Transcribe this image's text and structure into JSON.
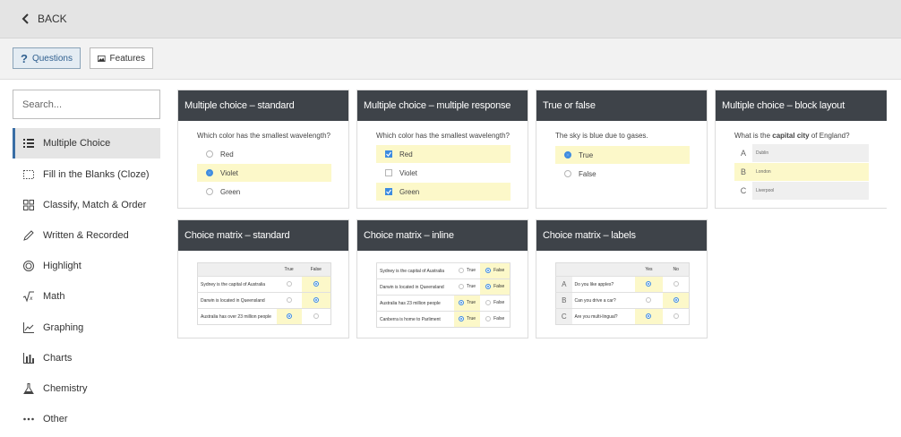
{
  "topbar": {
    "back_label": "BACK"
  },
  "tabs": [
    {
      "label": "Questions",
      "active": true
    },
    {
      "label": "Features",
      "active": false
    }
  ],
  "search": {
    "placeholder": "Search..."
  },
  "sidebar": {
    "items": [
      {
        "label": "Multiple Choice",
        "icon": "list-icon",
        "active": true
      },
      {
        "label": "Fill in the Blanks (Cloze)",
        "icon": "dashed-box-icon"
      },
      {
        "label": "Classify, Match & Order",
        "icon": "grid-icon"
      },
      {
        "label": "Written & Recorded",
        "icon": "pencil-icon"
      },
      {
        "label": "Highlight",
        "icon": "target-icon"
      },
      {
        "label": "Math",
        "icon": "sqrt-icon"
      },
      {
        "label": "Graphing",
        "icon": "line-graph-icon"
      },
      {
        "label": "Charts",
        "icon": "bar-chart-icon"
      },
      {
        "label": "Chemistry",
        "icon": "flask-icon"
      },
      {
        "label": "Other",
        "icon": "more-icon"
      }
    ]
  },
  "cards": {
    "mc_standard": {
      "title": "Multiple choice – standard",
      "question": "Which color has the smallest wavelength?",
      "options": [
        "Red",
        "Violet",
        "Green"
      ]
    },
    "mc_multi": {
      "title": "Multiple choice – multiple response",
      "question": "Which color has the smallest wavelength?",
      "options": [
        "Red",
        "Violet",
        "Green"
      ]
    },
    "true_false": {
      "title": "True or false",
      "question": "The sky is blue due to gases.",
      "options": [
        "True",
        "False"
      ]
    },
    "mc_block": {
      "title": "Multiple choice – block layout",
      "question_pre": "What is the ",
      "question_bold": "capital city",
      "question_post": " of England?",
      "options": [
        {
          "letter": "A",
          "text": "Dublin"
        },
        {
          "letter": "B",
          "text": "London"
        },
        {
          "letter": "C",
          "text": "Liverpool"
        }
      ]
    },
    "cm_standard": {
      "title": "Choice matrix – standard",
      "columns": [
        "True",
        "False"
      ],
      "rows": [
        "Sydney is the capital of Australia",
        "Darwin is located in Queensland",
        "Australia has over 23 million people"
      ]
    },
    "cm_inline": {
      "title": "Choice matrix – inline",
      "rows": [
        "Sydney is the capital of Australia",
        "Darwin is located in Queensland",
        "Australia has 23 million people",
        "Canberra is home to Parliment"
      ],
      "true_label": "True",
      "false_label": "False"
    },
    "cm_labels": {
      "title": "Choice matrix – labels",
      "columns": [
        "Yes",
        "No"
      ],
      "rows": [
        {
          "letter": "A",
          "text": "Do you like apples?"
        },
        {
          "letter": "B",
          "text": "Can you drive a car?"
        },
        {
          "letter": "C",
          "text": "Are you multi-lingual?"
        }
      ]
    }
  }
}
